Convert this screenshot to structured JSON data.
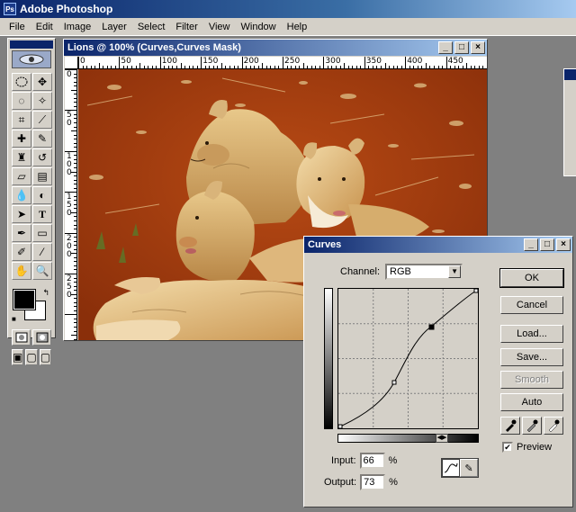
{
  "app": {
    "title": "Adobe Photoshop"
  },
  "menu": [
    "File",
    "Edit",
    "Image",
    "Layer",
    "Select",
    "Filter",
    "View",
    "Window",
    "Help"
  ],
  "document": {
    "title": "Lions @ 100% (Curves,Curves Mask)",
    "ruler_top": [
      "0",
      "50",
      "100",
      "150",
      "200",
      "250",
      "300",
      "350",
      "400",
      "450"
    ],
    "ruler_left": [
      "0",
      "5\n0",
      "1\n0\n0",
      "1\n5\n0",
      "2\n0\n0",
      "2\n5\n0"
    ]
  },
  "window_buttons": {
    "minimize": "_",
    "maximize": "□",
    "close": "×"
  },
  "curves": {
    "title": "Curves",
    "channel_label": "Channel:",
    "channel_value": "RGB",
    "input_label": "Input:",
    "input_value": "66",
    "output_label": "Output:",
    "output_value": "73",
    "percent": "%",
    "buttons": {
      "ok": "OK",
      "cancel": "Cancel",
      "load": "Load...",
      "save": "Save...",
      "smooth": "Smooth",
      "auto": "Auto"
    },
    "preview_label": "Preview",
    "preview_checked": true
  },
  "colors": {
    "foreground": "#000000",
    "background": "#ffffff",
    "titlebar": "#0a246a",
    "chrome": "#d4d0c8"
  },
  "tools": [
    "marquee-icon",
    "move-icon",
    "lasso-icon",
    "magic-wand-icon",
    "crop-icon",
    "slice-icon",
    "healing-brush-icon",
    "brush-icon",
    "clone-stamp-icon",
    "history-brush-icon",
    "eraser-icon",
    "gradient-icon",
    "blur-icon",
    "dodge-icon",
    "path-selection-icon",
    "type-icon",
    "pen-icon",
    "shape-icon",
    "notes-icon",
    "eyedropper-icon",
    "hand-icon",
    "zoom-icon"
  ]
}
